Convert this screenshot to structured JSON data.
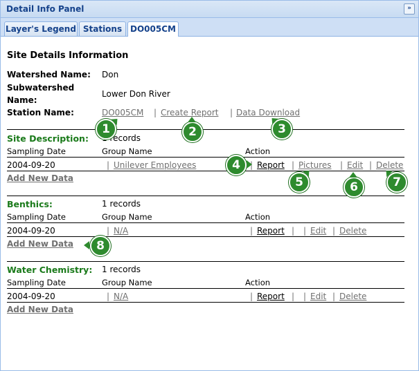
{
  "panel": {
    "title": "Detail Info Panel",
    "collapse_glyph": "»"
  },
  "tabs": [
    {
      "label": "Layer's Legend"
    },
    {
      "label": "Stations"
    },
    {
      "label": "DO005CM"
    }
  ],
  "site": {
    "heading": "Site Details Information",
    "watershed_label": "Watershed Name:",
    "watershed_value": "Don",
    "subwatershed_label_1": "Subwatershed",
    "subwatershed_label_2": "Name:",
    "subwatershed_value": "Lower Don River",
    "station_label": "Station Name:",
    "station_link": "DO005CM",
    "sep": "|",
    "create_report": "Create Report",
    "data_download": "Data Download"
  },
  "columns": {
    "date": "Sampling Date",
    "group": "Group Name",
    "action": "Action"
  },
  "actions": {
    "report": "Report",
    "pictures": "Pictures",
    "edit": "Edit",
    "delete": "Delete",
    "add_new": "Add New Data"
  },
  "sections": [
    {
      "title": "Site Description:",
      "records": "1 records",
      "date": "2004-09-20",
      "group": "Unilever Employees"
    },
    {
      "title": "Benthics:",
      "records": "1 records",
      "date": "2004-09-20",
      "group": "N/A"
    },
    {
      "title": "Water Chemistry:",
      "records": "1 records",
      "date": "2004-09-20",
      "group": "N/A"
    }
  ],
  "callouts": [
    "1",
    "2",
    "3",
    "4",
    "5",
    "6",
    "7",
    "8"
  ],
  "colors": {
    "badge": "#2e8b2e",
    "section_title": "#1a7a1a",
    "panel_border": "#99bbe8"
  }
}
